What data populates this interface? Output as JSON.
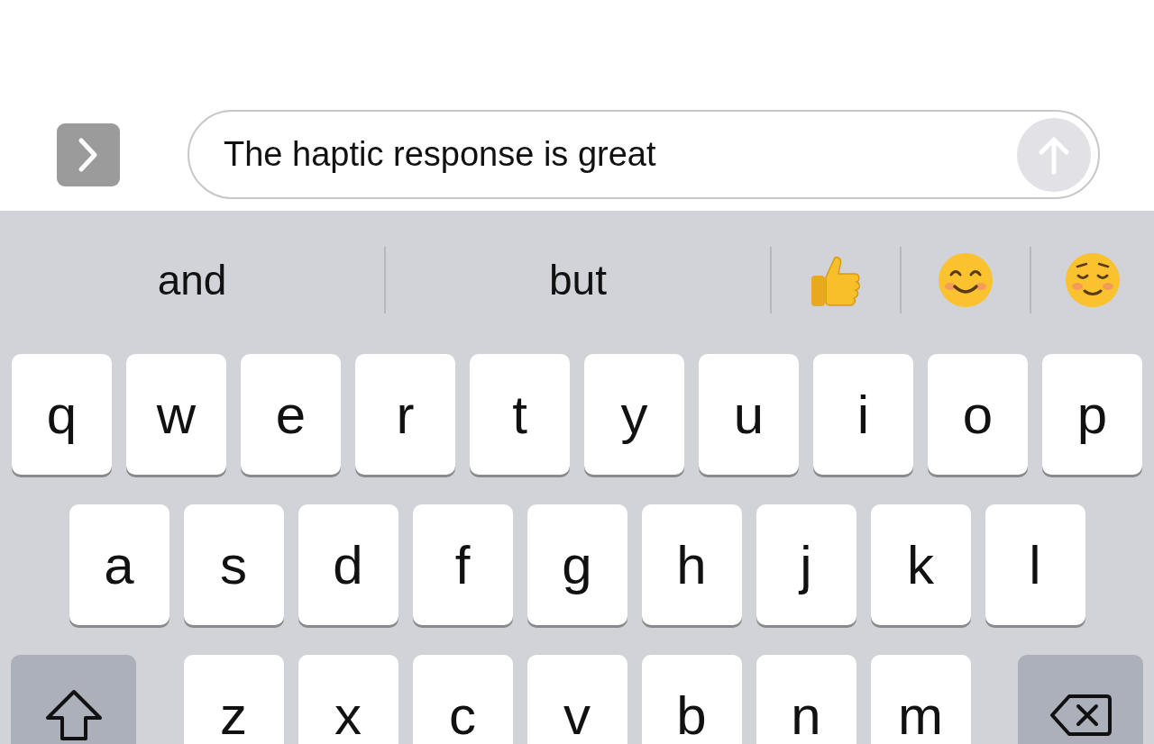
{
  "composer": {
    "value": "The haptic response is great"
  },
  "suggestions": [
    {
      "text": "and"
    },
    {
      "text": "but"
    }
  ],
  "keyboard": {
    "rows": [
      [
        "q",
        "w",
        "e",
        "r",
        "t",
        "y",
        "u",
        "i",
        "o",
        "p"
      ],
      [
        "a",
        "s",
        "d",
        "f",
        "g",
        "h",
        "j",
        "k",
        "l"
      ],
      [
        "z",
        "x",
        "c",
        "v",
        "b",
        "n",
        "m"
      ]
    ]
  }
}
